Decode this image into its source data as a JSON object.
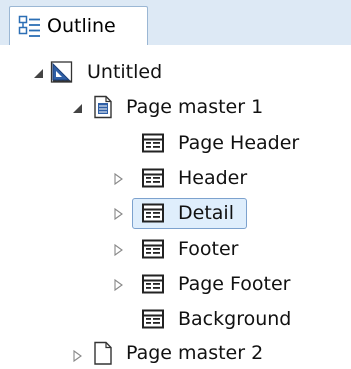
{
  "tab": {
    "label": "Outline",
    "icon": "outline-icon"
  },
  "tree": {
    "root": {
      "label": "Untitled",
      "icon": "report-design-icon",
      "state": "expanded"
    },
    "page_master_1": {
      "label": "Page master 1",
      "icon": "page-document-icon",
      "state": "expanded",
      "children": [
        {
          "label": "Page Header",
          "icon": "band-icon",
          "expander": "none"
        },
        {
          "label": "Header",
          "icon": "band-icon",
          "expander": "collapsed"
        },
        {
          "label": "Detail",
          "icon": "band-icon",
          "expander": "collapsed",
          "selected": true
        },
        {
          "label": "Footer",
          "icon": "band-icon",
          "expander": "collapsed"
        },
        {
          "label": "Page Footer",
          "icon": "band-icon",
          "expander": "collapsed"
        },
        {
          "label": "Background",
          "icon": "band-icon",
          "expander": "none"
        }
      ]
    },
    "page_master_2": {
      "label": "Page master 2",
      "icon": "blank-page-icon",
      "state": "collapsed"
    }
  },
  "colors": {
    "tab_bar_bg": "#dde9f5",
    "selection_bg": "#dfeefc",
    "selection_border": "#7da2ce"
  }
}
